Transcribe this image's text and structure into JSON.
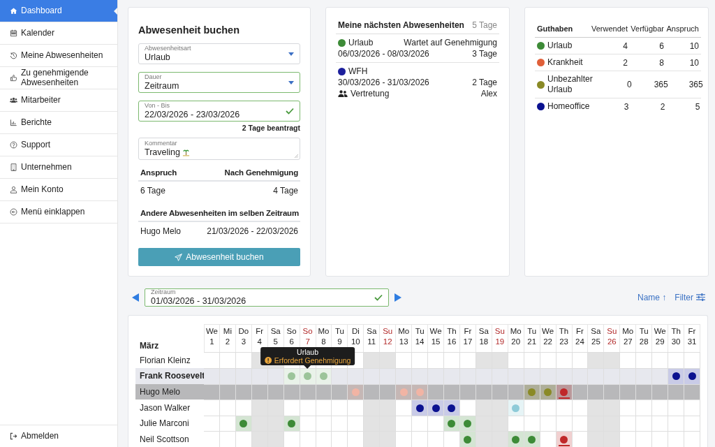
{
  "sidebar": {
    "items": [
      {
        "label": "Dashboard",
        "selected": true
      },
      {
        "label": "Kalender",
        "selected": false
      },
      {
        "label": "Meine Abwesenheiten",
        "selected": false
      },
      {
        "label": "Zu genehmigende Abwesenheiten",
        "selected": false
      },
      {
        "label": "Mitarbeiter",
        "selected": false
      },
      {
        "label": "Berichte",
        "selected": false
      },
      {
        "label": "Support",
        "selected": false
      },
      {
        "label": "Unternehmen",
        "selected": false
      },
      {
        "label": "Mein Konto",
        "selected": false
      },
      {
        "label": "Menü einklappen",
        "selected": false
      }
    ],
    "logout": "Abmelden"
  },
  "booking": {
    "title": "Abwesenheit buchen",
    "fields": [
      {
        "kind": "select",
        "label": "Abwesenheitsart",
        "value": "Urlaub",
        "valid": false
      },
      {
        "kind": "select",
        "label": "Dauer",
        "value": "Zeitraum",
        "valid": true
      },
      {
        "kind": "date",
        "label": "Von - Bis",
        "value": "22/03/2026 - 23/03/2026",
        "valid": true,
        "hint": "2 Tage beantragt"
      },
      {
        "kind": "textarea",
        "label": "Kommentar",
        "value": "Traveling",
        "valid": false
      }
    ],
    "balance": {
      "headers": [
        "Anspruch",
        "Nach Genehmigung"
      ],
      "values": [
        "6 Tage",
        "4 Tage"
      ]
    },
    "others": {
      "title": "Andere Abwesenheiten im selben Zeitraum",
      "rows": [
        {
          "name": "Hugo Melo",
          "range": "21/03/2026 - 22/03/2026"
        }
      ]
    },
    "button": "Abwesenheit buchen"
  },
  "upcoming": {
    "title": "Meine nächsten Abwesenheiten",
    "total": "5 Tage",
    "items": [
      {
        "type": "Urlaub",
        "color": "#3d8b37",
        "status": "Wartet auf Genehmigung",
        "range": "06/03/2026 - 08/03/2026",
        "days": "3 Tage"
      },
      {
        "type": "WFH",
        "color": "#1c1f9c",
        "range": "30/03/2026 - 31/03/2026",
        "days": "2 Tage",
        "substitute": {
          "label": "Vertretung",
          "name": "Alex"
        }
      }
    ]
  },
  "credits": {
    "columns": [
      "Guthaben",
      "Verwendet",
      "Verfügbar",
      "Anspruch"
    ],
    "rows": [
      {
        "name": "Urlaub",
        "color": "#3d8b37",
        "used": "4",
        "available": "6",
        "total": "10"
      },
      {
        "name": "Krankheit",
        "color": "#e0603a",
        "used": "2",
        "available": "8",
        "total": "10"
      },
      {
        "name": "Unbezahlter Urlaub",
        "color": "#8a8a26",
        "used": "0",
        "available": "365",
        "total": "365"
      },
      {
        "name": "Homeoffice",
        "color": "#0b1190",
        "used": "3",
        "available": "2",
        "total": "5"
      }
    ]
  },
  "calendar": {
    "period": {
      "label": "Zeitraum",
      "value": "01/03/2026 - 31/03/2026"
    },
    "sort": "Name ↑",
    "filter": "Filter",
    "month": "März",
    "days": [
      {
        "dow": "We",
        "day": "1",
        "holiday": false,
        "weekend": false
      },
      {
        "dow": "Mi",
        "day": "2",
        "holiday": false,
        "weekend": false
      },
      {
        "dow": "Do",
        "day": "3",
        "holiday": false,
        "weekend": false
      },
      {
        "dow": "Fr",
        "day": "4",
        "holiday": false,
        "weekend": true
      },
      {
        "dow": "Sa",
        "day": "5",
        "holiday": false,
        "weekend": true
      },
      {
        "dow": "So",
        "day": "6",
        "holiday": false,
        "weekend": false
      },
      {
        "dow": "So",
        "day": "7",
        "holiday": true,
        "weekend": false
      },
      {
        "dow": "Mo",
        "day": "8",
        "holiday": false,
        "weekend": false
      },
      {
        "dow": "Tu",
        "day": "9",
        "holiday": false,
        "weekend": false
      },
      {
        "dow": "Di",
        "day": "10",
        "holiday": false,
        "weekend": false
      },
      {
        "dow": "Sa",
        "day": "11",
        "holiday": false,
        "weekend": true
      },
      {
        "dow": "Su",
        "day": "12",
        "holiday": true,
        "weekend": true
      },
      {
        "dow": "Mo",
        "day": "13",
        "holiday": false,
        "weekend": false
      },
      {
        "dow": "Tu",
        "day": "14",
        "holiday": false,
        "weekend": false
      },
      {
        "dow": "We",
        "day": "15",
        "holiday": false,
        "weekend": false
      },
      {
        "dow": "Th",
        "day": "16",
        "holiday": false,
        "weekend": false
      },
      {
        "dow": "Fr",
        "day": "17",
        "holiday": false,
        "weekend": false
      },
      {
        "dow": "Sa",
        "day": "18",
        "holiday": false,
        "weekend": true
      },
      {
        "dow": "Su",
        "day": "19",
        "holiday": true,
        "weekend": true
      },
      {
        "dow": "Mo",
        "day": "20",
        "holiday": false,
        "weekend": false
      },
      {
        "dow": "Tu",
        "day": "21",
        "holiday": false,
        "weekend": false
      },
      {
        "dow": "We",
        "day": "22",
        "holiday": false,
        "weekend": false
      },
      {
        "dow": "Th",
        "day": "23",
        "holiday": false,
        "weekend": false
      },
      {
        "dow": "Fr",
        "day": "24",
        "holiday": false,
        "weekend": false
      },
      {
        "dow": "Sa",
        "day": "25",
        "holiday": false,
        "weekend": true
      },
      {
        "dow": "Su",
        "day": "26",
        "holiday": true,
        "weekend": true
      },
      {
        "dow": "Mo",
        "day": "27",
        "holiday": false,
        "weekend": false
      },
      {
        "dow": "Tu",
        "day": "28",
        "holiday": false,
        "weekend": false
      },
      {
        "dow": "We",
        "day": "29",
        "holiday": false,
        "weekend": false
      },
      {
        "dow": "Th",
        "day": "30",
        "holiday": false,
        "weekend": false
      },
      {
        "dow": "Fr",
        "day": "31",
        "holiday": false,
        "weekend": false
      }
    ],
    "rows": [
      {
        "name": "Florian Kleinz",
        "current": false,
        "selected": false,
        "cells": [
          {
            "dot": false
          },
          {
            "dot": false
          },
          {
            "dot": false
          },
          {
            "dot": false
          },
          {
            "dot": false
          },
          {
            "dot": false
          },
          {
            "dot": false
          },
          {
            "dot": false
          },
          {
            "dot": false
          },
          {
            "dot": false
          },
          {
            "dot": false
          },
          {
            "dot": false
          },
          {
            "dot": false
          },
          {
            "dot": false
          },
          {
            "dot": false
          },
          {
            "dot": false
          },
          {
            "dot": false
          },
          {
            "dot": false
          },
          {
            "dot": false
          },
          {
            "dot": false
          },
          {
            "dot": false
          },
          {
            "dot": false
          },
          {
            "dot": false
          },
          {
            "dot": false
          },
          {
            "dot": false
          },
          {
            "dot": false
          },
          {
            "dot": false
          },
          {
            "dot": false
          },
          {
            "dot": false
          },
          {
            "dot": false
          },
          {
            "dot": false
          }
        ]
      },
      {
        "name": "Frank Roosevelt",
        "current": true,
        "selected": false,
        "cells": [
          {
            "dot": false
          },
          {
            "dot": false
          },
          {
            "dot": false
          },
          {
            "dot": false
          },
          {
            "dot": false
          },
          {
            "dot": true,
            "color": "#9cc49a",
            "underlined": false
          },
          {
            "dot": true,
            "color": "#9cc49a",
            "underlined": false,
            "tooltip": {
              "title": "Urlaub",
              "note": "Erfordert Genehmigung"
            }
          },
          {
            "dot": true,
            "color": "#9cc49a",
            "underlined": false
          },
          {
            "dot": false
          },
          {
            "dot": false
          },
          {
            "dot": false
          },
          {
            "dot": false
          },
          {
            "dot": false
          },
          {
            "dot": false
          },
          {
            "dot": false
          },
          {
            "dot": false
          },
          {
            "dot": false
          },
          {
            "dot": false
          },
          {
            "dot": false
          },
          {
            "dot": false
          },
          {
            "dot": false
          },
          {
            "dot": false
          },
          {
            "dot": false
          },
          {
            "dot": false
          },
          {
            "dot": false
          },
          {
            "dot": false
          },
          {
            "dot": false
          },
          {
            "dot": false
          },
          {
            "dot": false
          },
          {
            "dot": true,
            "color": "#0b1190",
            "underlined": false
          },
          {
            "dot": true,
            "color": "#0b1190",
            "underlined": false
          }
        ]
      },
      {
        "name": "Hugo Melo",
        "current": false,
        "selected": true,
        "cells": [
          {
            "dot": false
          },
          {
            "dot": false
          },
          {
            "dot": false
          },
          {
            "dot": false
          },
          {
            "dot": false
          },
          {
            "dot": false
          },
          {
            "dot": false
          },
          {
            "dot": false
          },
          {
            "dot": false
          },
          {
            "dot": true,
            "color": "#f2b4a4",
            "underlined": false
          },
          {
            "dot": false
          },
          {
            "dot": false
          },
          {
            "dot": true,
            "color": "#f2b4a4",
            "underlined": false
          },
          {
            "dot": true,
            "color": "#f2b4a4",
            "underlined": false
          },
          {
            "dot": false
          },
          {
            "dot": false
          },
          {
            "dot": false
          },
          {
            "dot": false
          },
          {
            "dot": false
          },
          {
            "dot": false
          },
          {
            "dot": true,
            "color": "#8a8a26",
            "underlined": false
          },
          {
            "dot": true,
            "color": "#8a8a26",
            "underlined": false
          },
          {
            "dot": true,
            "color": "#c0282a",
            "underlined": true
          },
          {
            "dot": false
          },
          {
            "dot": false
          },
          {
            "dot": false
          },
          {
            "dot": false
          },
          {
            "dot": false
          },
          {
            "dot": false
          },
          {
            "dot": false
          },
          {
            "dot": false
          }
        ]
      },
      {
        "name": "Jason Walker",
        "current": false,
        "selected": false,
        "cells": [
          {
            "dot": false
          },
          {
            "dot": false
          },
          {
            "dot": false
          },
          {
            "dot": false
          },
          {
            "dot": false
          },
          {
            "dot": false
          },
          {
            "dot": false
          },
          {
            "dot": false
          },
          {
            "dot": false
          },
          {
            "dot": false
          },
          {
            "dot": false
          },
          {
            "dot": false
          },
          {
            "dot": false
          },
          {
            "dot": true,
            "color": "#0b1190",
            "underlined": false
          },
          {
            "dot": true,
            "color": "#0b1190",
            "underlined": false
          },
          {
            "dot": true,
            "color": "#0b1190",
            "underlined": false
          },
          {
            "dot": false
          },
          {
            "dot": false
          },
          {
            "dot": false
          },
          {
            "dot": true,
            "color": "#8ecbd8",
            "underlined": false
          },
          {
            "dot": false
          },
          {
            "dot": false
          },
          {
            "dot": false
          },
          {
            "dot": false
          },
          {
            "dot": false
          },
          {
            "dot": false
          },
          {
            "dot": false
          },
          {
            "dot": false
          },
          {
            "dot": false
          },
          {
            "dot": false
          },
          {
            "dot": false
          }
        ]
      },
      {
        "name": "Julie Marconi",
        "current": false,
        "selected": false,
        "cells": [
          {
            "dot": false
          },
          {
            "dot": false
          },
          {
            "dot": true,
            "color": "#3d8b37",
            "underlined": false
          },
          {
            "dot": false
          },
          {
            "dot": false
          },
          {
            "dot": true,
            "color": "#3d8b37",
            "underlined": false
          },
          {
            "dot": false
          },
          {
            "dot": false
          },
          {
            "dot": false
          },
          {
            "dot": false
          },
          {
            "dot": false
          },
          {
            "dot": false
          },
          {
            "dot": false
          },
          {
            "dot": false
          },
          {
            "dot": false
          },
          {
            "dot": true,
            "color": "#3d8b37",
            "underlined": false
          },
          {
            "dot": true,
            "color": "#3d8b37",
            "underlined": false
          },
          {
            "dot": false
          },
          {
            "dot": false
          },
          {
            "dot": false
          },
          {
            "dot": false
          },
          {
            "dot": false
          },
          {
            "dot": false
          },
          {
            "dot": false
          },
          {
            "dot": false
          },
          {
            "dot": false
          },
          {
            "dot": false
          },
          {
            "dot": false
          },
          {
            "dot": false
          },
          {
            "dot": false
          },
          {
            "dot": false
          }
        ]
      },
      {
        "name": "Neil Scottson",
        "current": false,
        "selected": false,
        "cells": [
          {
            "dot": false
          },
          {
            "dot": false
          },
          {
            "dot": false
          },
          {
            "dot": false
          },
          {
            "dot": false
          },
          {
            "dot": false
          },
          {
            "dot": false
          },
          {
            "dot": false
          },
          {
            "dot": false
          },
          {
            "dot": false
          },
          {
            "dot": false
          },
          {
            "dot": false
          },
          {
            "dot": false
          },
          {
            "dot": false
          },
          {
            "dot": false
          },
          {
            "dot": false
          },
          {
            "dot": true,
            "color": "#3d8b37",
            "underlined": false
          },
          {
            "dot": false
          },
          {
            "dot": false
          },
          {
            "dot": true,
            "color": "#3d8b37",
            "underlined": false
          },
          {
            "dot": true,
            "color": "#3d8b37",
            "underlined": false
          },
          {
            "dot": false
          },
          {
            "dot": true,
            "color": "#c0282a",
            "underlined": true
          },
          {
            "dot": false
          },
          {
            "dot": false
          },
          {
            "dot": false
          },
          {
            "dot": false
          },
          {
            "dot": false
          },
          {
            "dot": false
          },
          {
            "dot": false
          },
          {
            "dot": false
          }
        ]
      }
    ]
  }
}
